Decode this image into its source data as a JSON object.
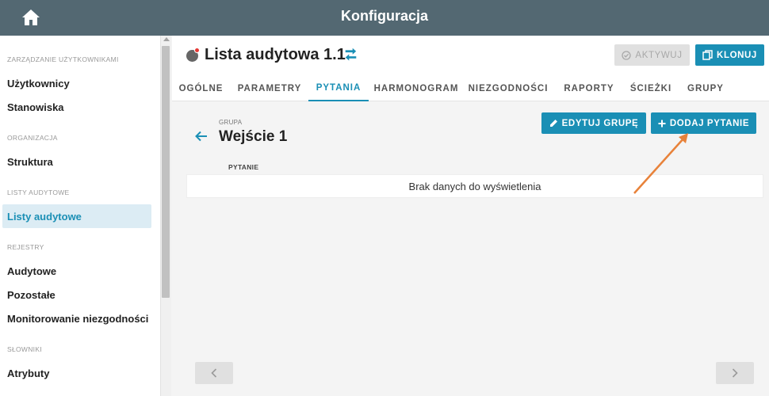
{
  "header": {
    "title": "Konfiguracja",
    "home_icon": "home-icon"
  },
  "sidebar": {
    "sections": [
      {
        "label": "ZARZĄDZANIE UŻYTKOWNIKAMI",
        "items": [
          "Użytkownicy",
          "Stanowiska"
        ]
      },
      {
        "label": "ORGANIZACJA",
        "items": [
          "Struktura"
        ]
      },
      {
        "label": "LISTY AUDYTOWE",
        "items": [
          "Listy audytowe"
        ]
      },
      {
        "label": "REJESTRY",
        "items": [
          "Audytowe",
          "Pozostałe",
          "Monitorowanie niezgodności"
        ]
      },
      {
        "label": "SŁOWNIKI",
        "items": [
          "Atrybuty"
        ]
      }
    ],
    "active_item": "Listy audytowe"
  },
  "page": {
    "title": "Lista audytowa 1.1",
    "activate_label": "AKTYWUJ",
    "clone_label": "KLONUJ",
    "tabs": [
      "OGÓLNE",
      "PARAMETRY",
      "PYTANIA",
      "HARMONOGRAM",
      "NIEZGODNOŚCI",
      "RAPORTY",
      "ŚCIEŻKI",
      "GRUPY"
    ],
    "active_tab": "PYTANIA"
  },
  "content": {
    "group_label": "GRUPA",
    "group_name": "Wejście 1",
    "edit_group_label": "EDYTUJ GRUPĘ",
    "add_question_label": "DODAJ PYTANIE",
    "column_header": "PYTANIE",
    "empty_message": "Brak danych do wyświetlenia"
  },
  "colors": {
    "accent": "#1a8fb5",
    "topbar": "#536872",
    "annotation": "#e8823a"
  }
}
